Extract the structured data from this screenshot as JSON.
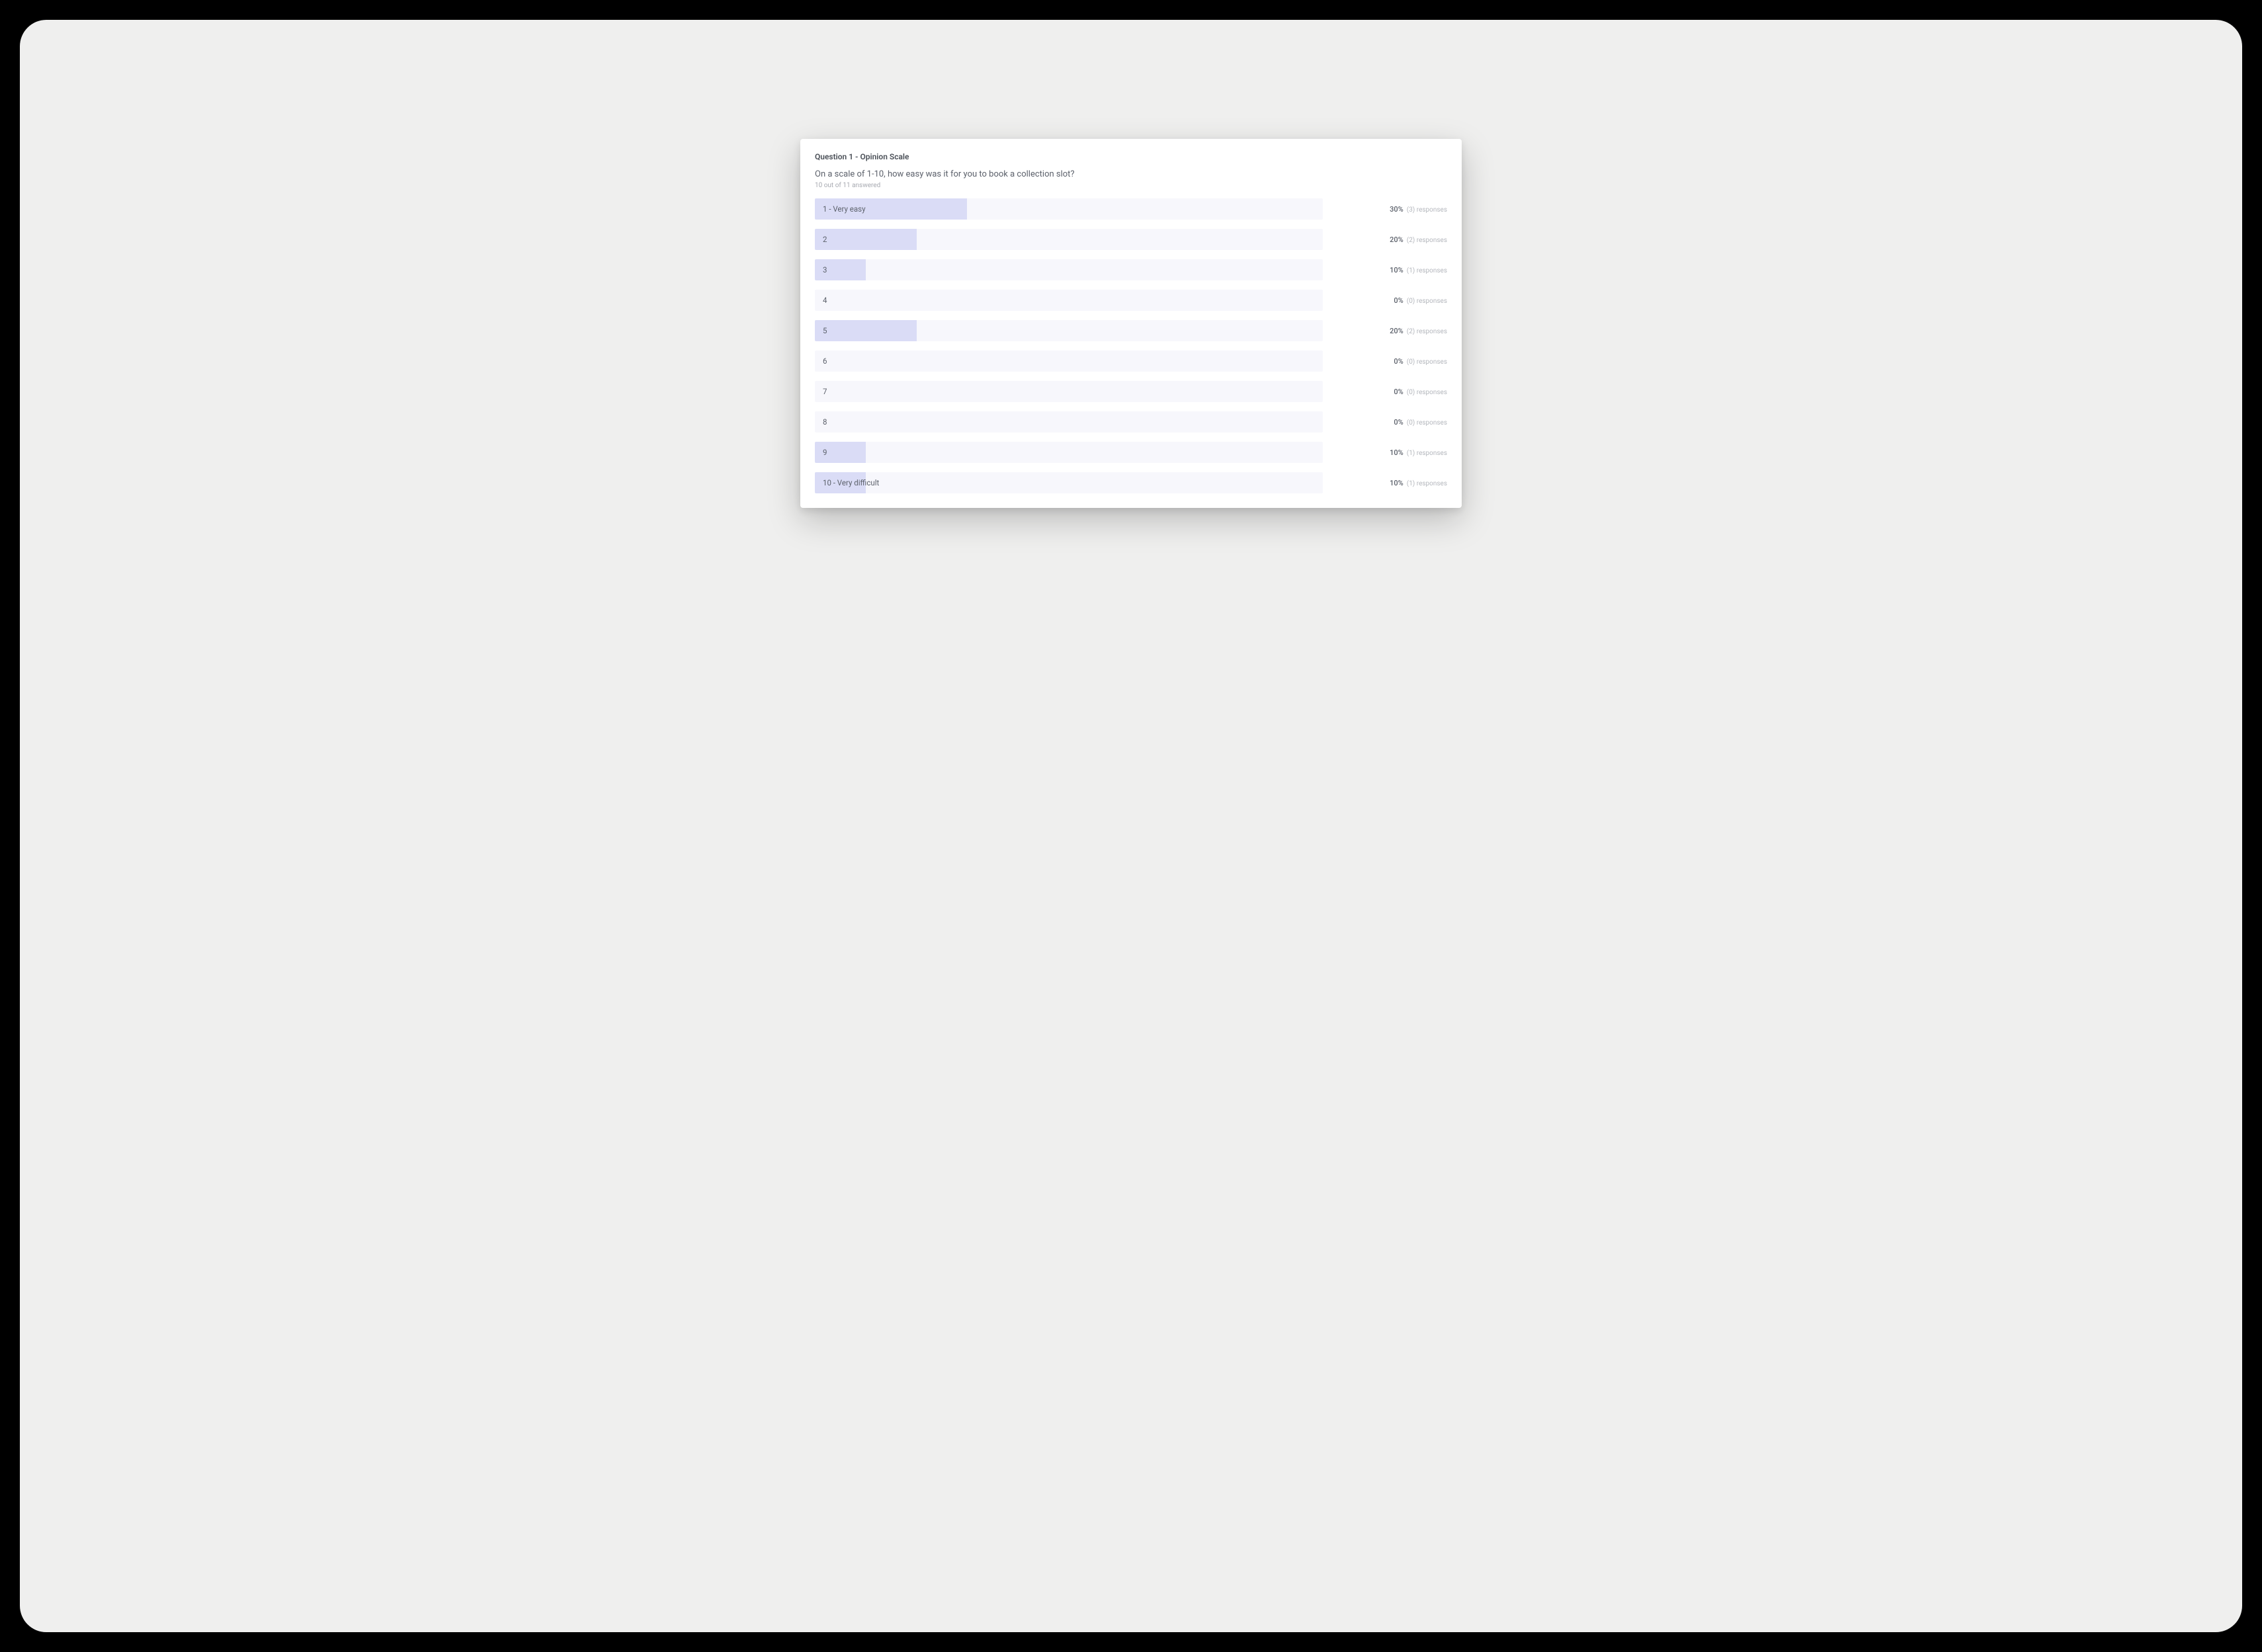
{
  "question": {
    "header": "Question 1 - Opinion Scale",
    "text": "On a scale of 1-10, how easy was it for you to book a collection slot?",
    "answered": "10 out of 11 answered"
  },
  "rows": [
    {
      "label": "1 - Very easy",
      "percent": 30,
      "count": 3
    },
    {
      "label": "2",
      "percent": 20,
      "count": 2
    },
    {
      "label": "3",
      "percent": 10,
      "count": 1
    },
    {
      "label": "4",
      "percent": 0,
      "count": 0
    },
    {
      "label": "5",
      "percent": 20,
      "count": 2
    },
    {
      "label": "6",
      "percent": 0,
      "count": 0
    },
    {
      "label": "7",
      "percent": 0,
      "count": 0
    },
    {
      "label": "8",
      "percent": 0,
      "count": 0
    },
    {
      "label": "9",
      "percent": 10,
      "count": 1
    },
    {
      "label": "10 - Very difficult",
      "percent": 10,
      "count": 1
    }
  ],
  "responses_word": "responses",
  "chart_data": {
    "type": "bar",
    "title": "Question 1 - Opinion Scale",
    "subtitle": "On a scale of 1-10, how easy was it for you to book a collection slot?",
    "categories": [
      "1 - Very easy",
      "2",
      "3",
      "4",
      "5",
      "6",
      "7",
      "8",
      "9",
      "10 - Very difficult"
    ],
    "series": [
      {
        "name": "Percent",
        "values": [
          30,
          20,
          10,
          0,
          20,
          0,
          0,
          0,
          10,
          10
        ]
      },
      {
        "name": "Responses",
        "values": [
          3,
          2,
          1,
          0,
          2,
          0,
          0,
          0,
          1,
          1
        ]
      }
    ],
    "xlabel": "",
    "ylabel": "Percent",
    "ylim": [
      0,
      100
    ],
    "total_answered": 10,
    "total_asked": 11
  }
}
